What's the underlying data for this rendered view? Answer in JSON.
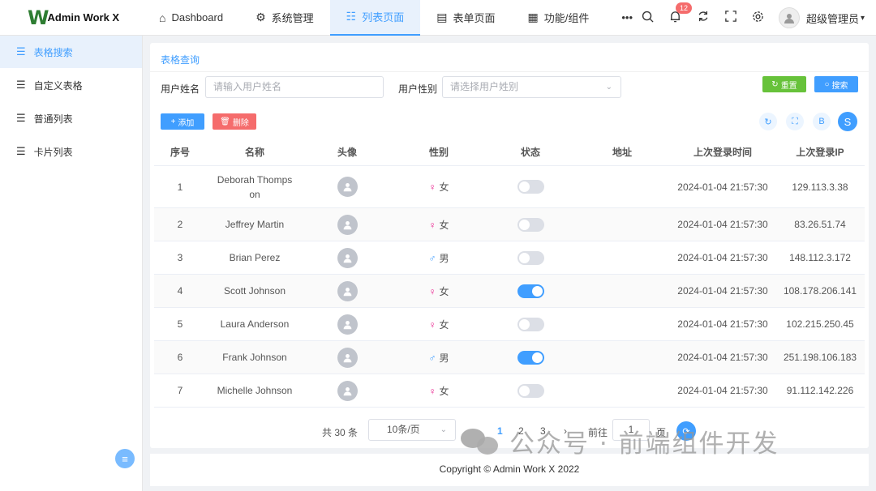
{
  "brand": {
    "logo_mark": "W",
    "name": "Admin Work X"
  },
  "top_nav": [
    {
      "label": "Dashboard",
      "icon": "⌂"
    },
    {
      "label": "系统管理",
      "icon": "⚙"
    },
    {
      "label": "列表页面",
      "icon": "☷"
    },
    {
      "label": "表单页面",
      "icon": "▤"
    },
    {
      "label": "功能/组件",
      "icon": "▦"
    },
    {
      "label": "•••",
      "icon": ""
    }
  ],
  "header": {
    "badge_count": "12",
    "user_name": "超级管理员",
    "user_caret": "▾"
  },
  "sidebar": {
    "items": [
      {
        "label": "表格搜索"
      },
      {
        "label": "自定义表格"
      },
      {
        "label": "普通列表"
      },
      {
        "label": "卡片列表"
      }
    ]
  },
  "card": {
    "title": "表格查询",
    "search": {
      "name_label": "用户姓名",
      "name_placeholder": "请输入用户姓名",
      "sex_label": "用户性别",
      "sex_placeholder": "请选择用户姓别",
      "reset_label": "重置",
      "search_label": "搜索"
    },
    "toolbar": {
      "add_label": "添加",
      "delete_label": "删除",
      "circle_b": "B",
      "circle_s": "S"
    }
  },
  "table": {
    "headers": [
      "序号",
      "名称",
      "头像",
      "性别",
      "状态",
      "地址",
      "上次登录时间",
      "上次登录IP"
    ],
    "rows": [
      {
        "no": "1",
        "name_line1": "Deborah Thomps",
        "name_line2": "on",
        "sex": "女",
        "status": false,
        "address": "",
        "time": "2024-01-04 21:57:30",
        "ip": "129.113.3.38"
      },
      {
        "no": "2",
        "name_line1": "Jeffrey Martin",
        "name_line2": "",
        "sex": "女",
        "status": false,
        "address": "",
        "time": "2024-01-04 21:57:30",
        "ip": "83.26.51.74"
      },
      {
        "no": "3",
        "name_line1": "Brian Perez",
        "name_line2": "",
        "sex": "男",
        "status": false,
        "address": "",
        "time": "2024-01-04 21:57:30",
        "ip": "148.112.3.172"
      },
      {
        "no": "4",
        "name_line1": "Scott Johnson",
        "name_line2": "",
        "sex": "女",
        "status": true,
        "address": "",
        "time": "2024-01-04 21:57:30",
        "ip": "108.178.206.141"
      },
      {
        "no": "5",
        "name_line1": "Laura Anderson",
        "name_line2": "",
        "sex": "女",
        "status": false,
        "address": "",
        "time": "2024-01-04 21:57:30",
        "ip": "102.215.250.45"
      },
      {
        "no": "6",
        "name_line1": "Frank Johnson",
        "name_line2": "",
        "sex": "男",
        "status": true,
        "address": "",
        "time": "2024-01-04 21:57:30",
        "ip": "251.198.106.183"
      },
      {
        "no": "7",
        "name_line1": "Michelle Johnson",
        "name_line2": "",
        "sex": "女",
        "status": false,
        "address": "",
        "time": "2024-01-04 21:57:30",
        "ip": "91.112.142.226"
      }
    ]
  },
  "pagination": {
    "total": "共 30 条",
    "page_size": "10条/页",
    "pages": [
      "1",
      "2",
      "3"
    ],
    "next": "›",
    "goto_label": "前往",
    "goto_value": "1",
    "page_unit": "页"
  },
  "footer": {
    "text": "Copyright © Admin Work X 2022"
  },
  "watermark": {
    "text": "公众号 · 前端组件开发"
  },
  "colors": {
    "primary": "#409eff",
    "success": "#67c23a",
    "danger": "#f56c6c",
    "female": "#e91e8c"
  }
}
